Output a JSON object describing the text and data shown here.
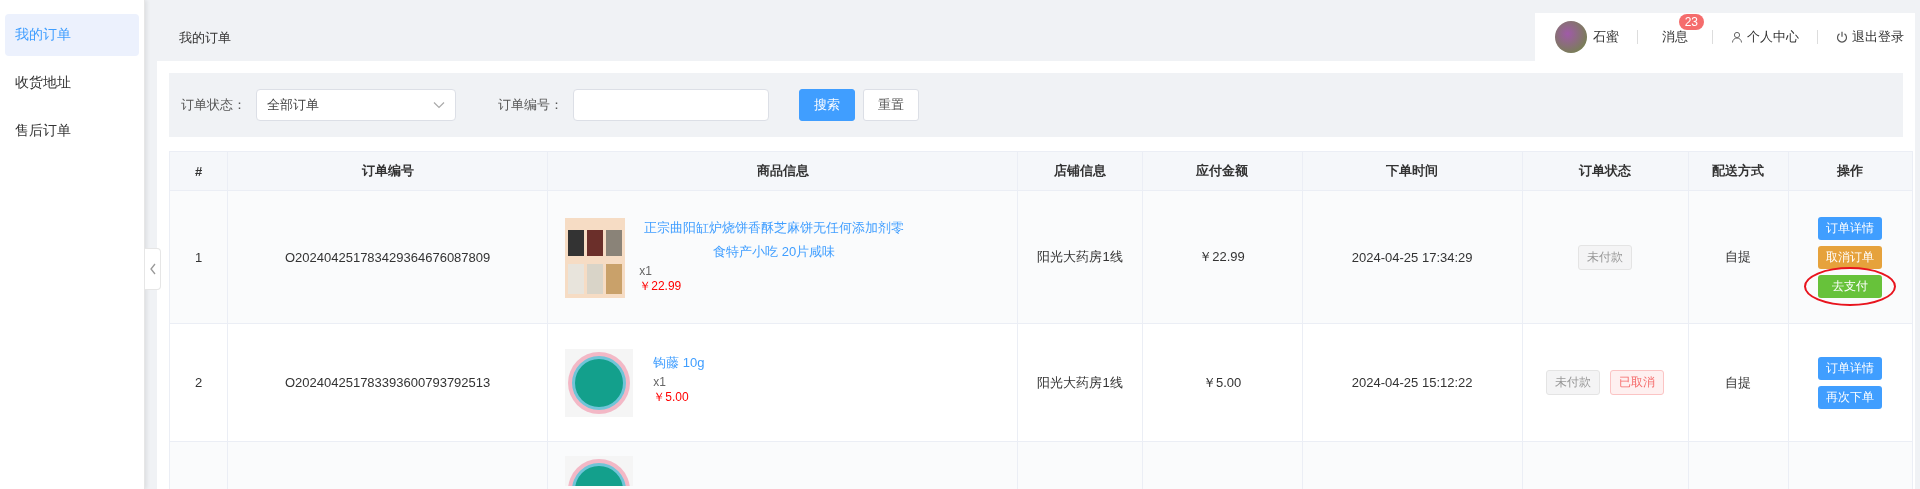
{
  "sidebar": {
    "items": [
      {
        "label": "我的订单",
        "selected": true
      },
      {
        "label": "收货地址",
        "selected": false
      },
      {
        "label": "售后订单",
        "selected": false
      }
    ]
  },
  "header": {
    "title": "我的订单",
    "user": {
      "name": "石蜜"
    },
    "messages": {
      "label": "消息",
      "badge": "23"
    },
    "profile": {
      "label": "个人中心"
    },
    "logout": {
      "label": "退出登录"
    }
  },
  "filter": {
    "status_label": "订单状态：",
    "status_value": "全部订单",
    "number_label": "订单编号：",
    "search_button": "搜索",
    "reset_button": "重置"
  },
  "table": {
    "columns": [
      "#",
      "订单编号",
      "商品信息",
      "店铺信息",
      "应付金额",
      "下单时间",
      "订单状态",
      "配送方式",
      "操作"
    ],
    "rows": [
      {
        "index": "1",
        "order_no": "O202404251783429364676087809",
        "kind": "food",
        "product": "正宗曲阳缸炉烧饼香酥芝麻饼无任何添加剂零食特产小吃 20片咸味",
        "qty": "x1",
        "price": "￥22.99",
        "shop": "阳光大药房1线",
        "amount": "￥22.99",
        "time": "2024-04-25 17:34:29",
        "statuses": [
          {
            "label": "未付款",
            "kind": "unpaid"
          }
        ],
        "delivery": "自提",
        "actions": [
          {
            "label": "订单详情",
            "kind": "primary",
            "highlighted": false
          },
          {
            "label": "取消订单",
            "kind": "warning",
            "highlighted": false
          },
          {
            "label": "去支付",
            "kind": "success",
            "highlighted": true
          }
        ]
      },
      {
        "index": "2",
        "order_no": "O202404251783393600793792513",
        "kind": "badge",
        "product": "钩藤 10g",
        "qty": "x1",
        "price": "￥5.00",
        "shop": "阳光大药房1线",
        "amount": "￥5.00",
        "time": "2024-04-25 15:12:22",
        "statuses": [
          {
            "label": "未付款",
            "kind": "unpaid"
          },
          {
            "label": "已取消",
            "kind": "cancelled"
          }
        ],
        "delivery": "自提",
        "actions": [
          {
            "label": "订单详情",
            "kind": "primary",
            "highlighted": false
          },
          {
            "label": "再次下单",
            "kind": "primary",
            "highlighted": false
          }
        ]
      },
      {
        "kind": "badge"
      }
    ]
  }
}
